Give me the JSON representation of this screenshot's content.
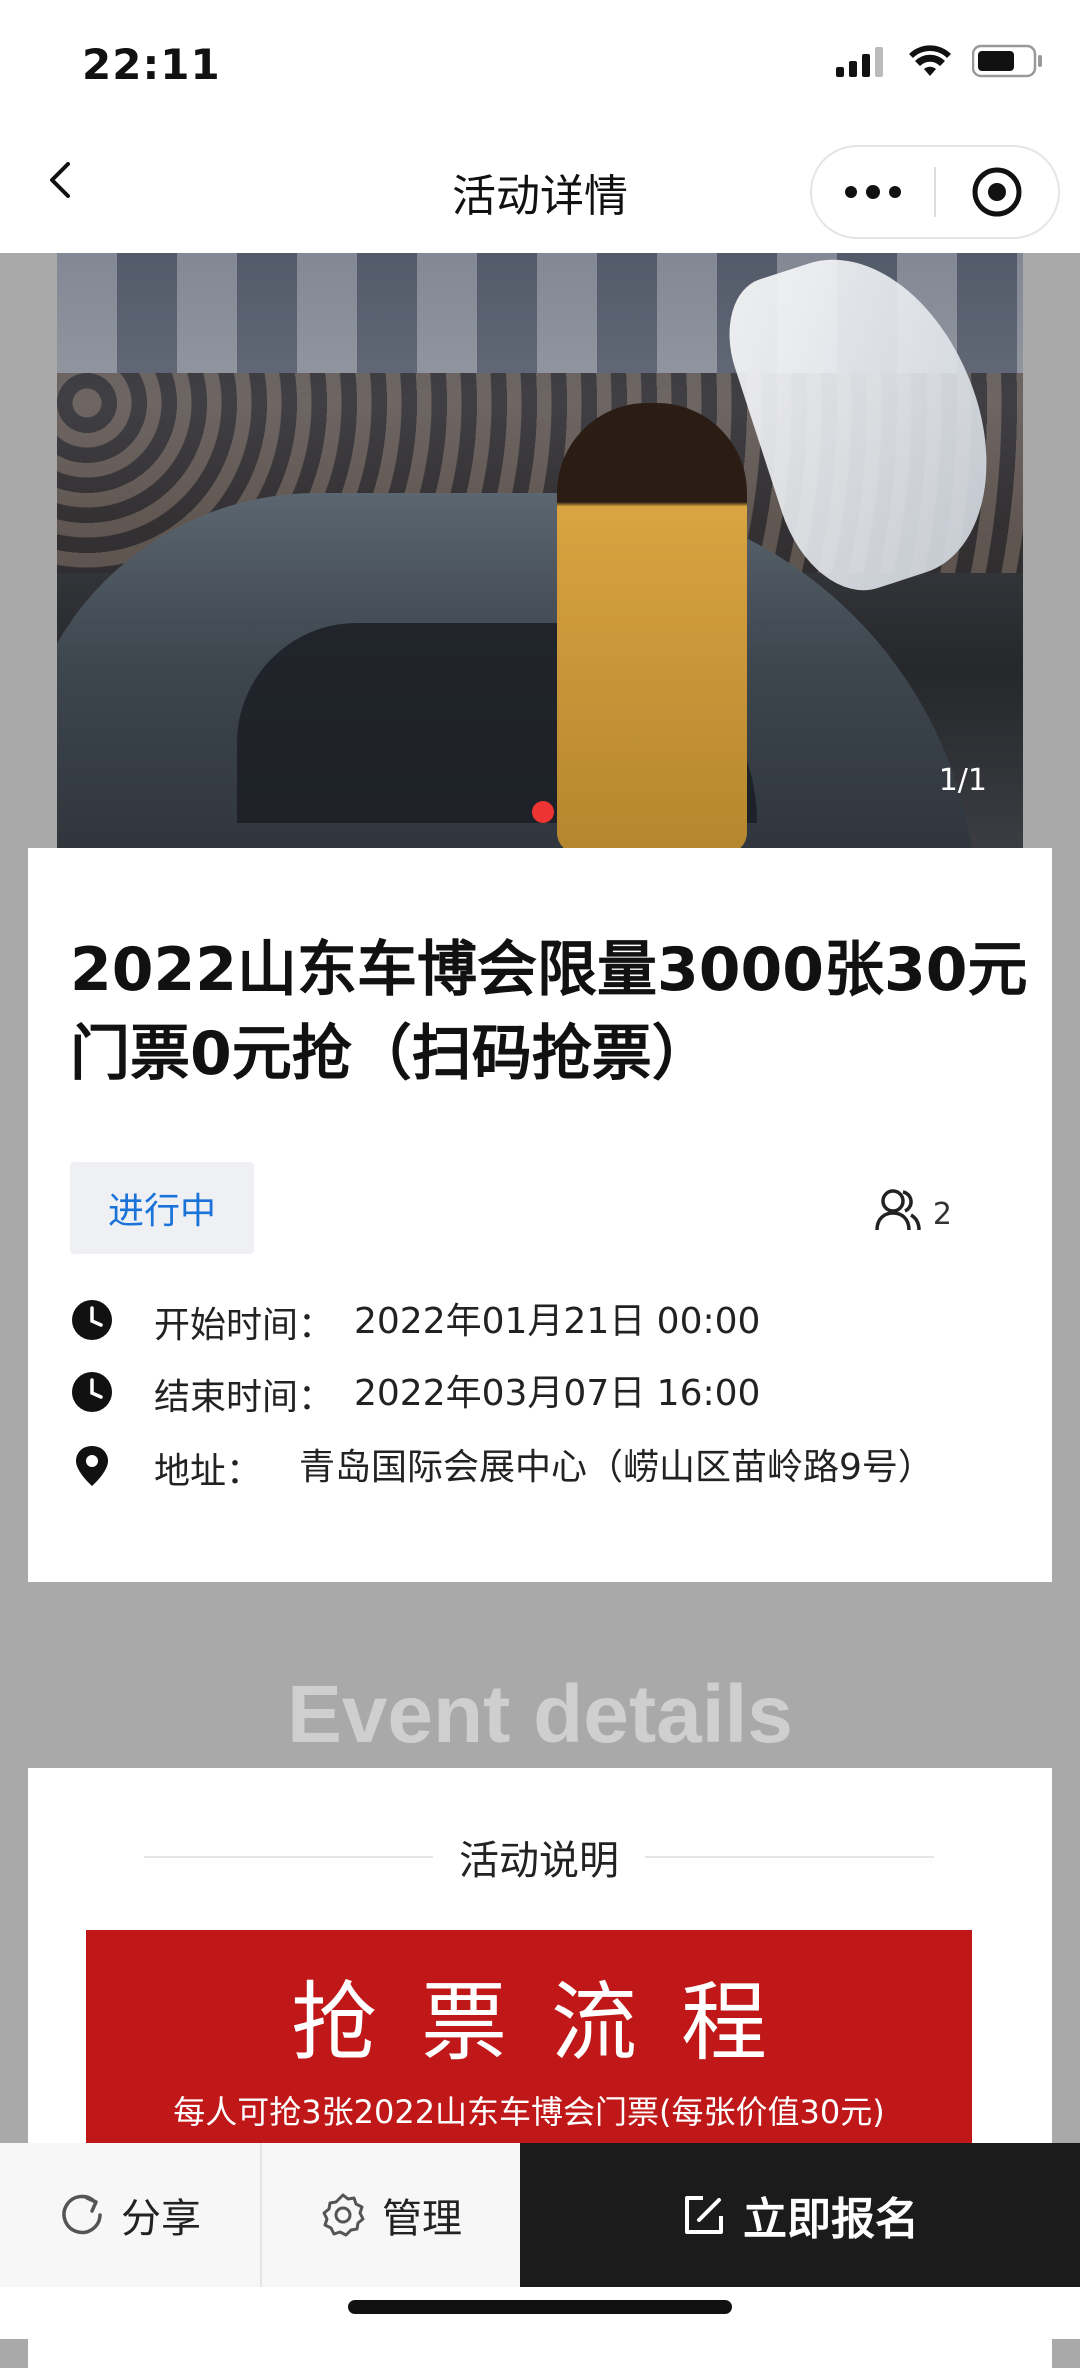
{
  "status_bar": {
    "time": "22:11"
  },
  "nav": {
    "title": "活动详情"
  },
  "hero": {
    "counter": "1/1"
  },
  "event": {
    "title": "2022山东车博会限量3000张30元门票0元抢（扫码抢票）",
    "status": "进行中",
    "participants": "2",
    "start_label": "开始时间：",
    "start_value": "2022年01月21日 00:00",
    "end_label": "结束时间：",
    "end_value": "2022年03月07日 16:00",
    "address_label": "地址：",
    "address_value": "青岛国际会展中心（崂山区苗岭路9号）"
  },
  "section_heading": "Event details",
  "description": {
    "heading": "活动说明",
    "banner_title": "抢票流程",
    "banner_subtitle": "每人可抢3张2022山东车博会门票(每张价值30元)"
  },
  "bottom_bar": {
    "share_label": "分享",
    "manage_label": "管理",
    "signup_label": "立即报名"
  }
}
